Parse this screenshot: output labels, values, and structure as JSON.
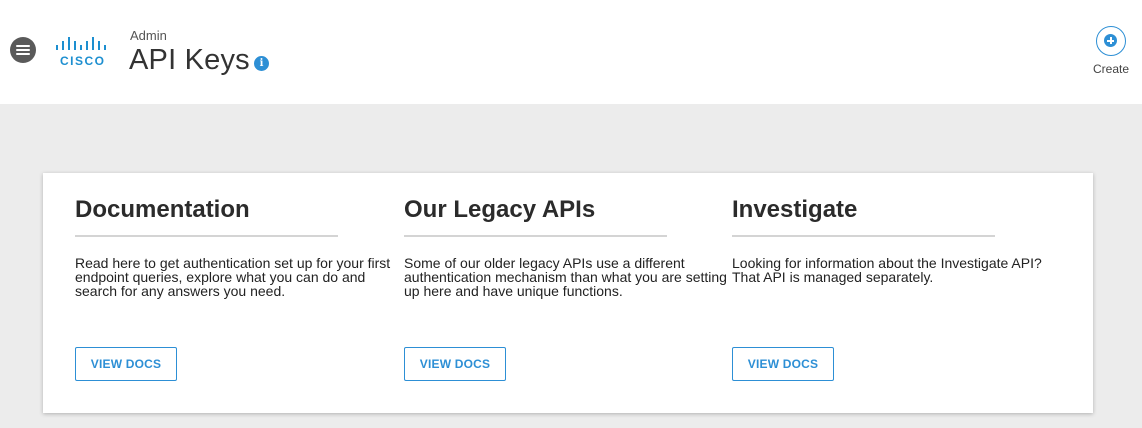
{
  "header": {
    "logo_text": "CISCO",
    "breadcrumb": "Admin",
    "title": "API Keys",
    "info_glyph": "i",
    "create_label": "Create"
  },
  "icons": {
    "menu": "hamburger-menu-icon",
    "logo": "cisco-logo",
    "info": "info-icon",
    "create": "plus-circle-icon"
  },
  "colors": {
    "accent": "#2d8fd5",
    "background": "#ececec",
    "header_bg": "#ffffff"
  },
  "cards": [
    {
      "title": "Documentation",
      "description": "Read here to get authentication set up for your first endpoint queries, explore what you can do and search for any answers you need.",
      "button_label": "VIEW DOCS"
    },
    {
      "title": "Our Legacy APIs",
      "description": "Some of our older legacy APIs use a different authentication mechanism than what you are setting up here and have unique functions.",
      "button_label": "VIEW DOCS"
    },
    {
      "title": "Investigate",
      "description": "Looking for information about the Investigate API? That API is managed separately.",
      "button_label": "VIEW DOCS"
    }
  ]
}
